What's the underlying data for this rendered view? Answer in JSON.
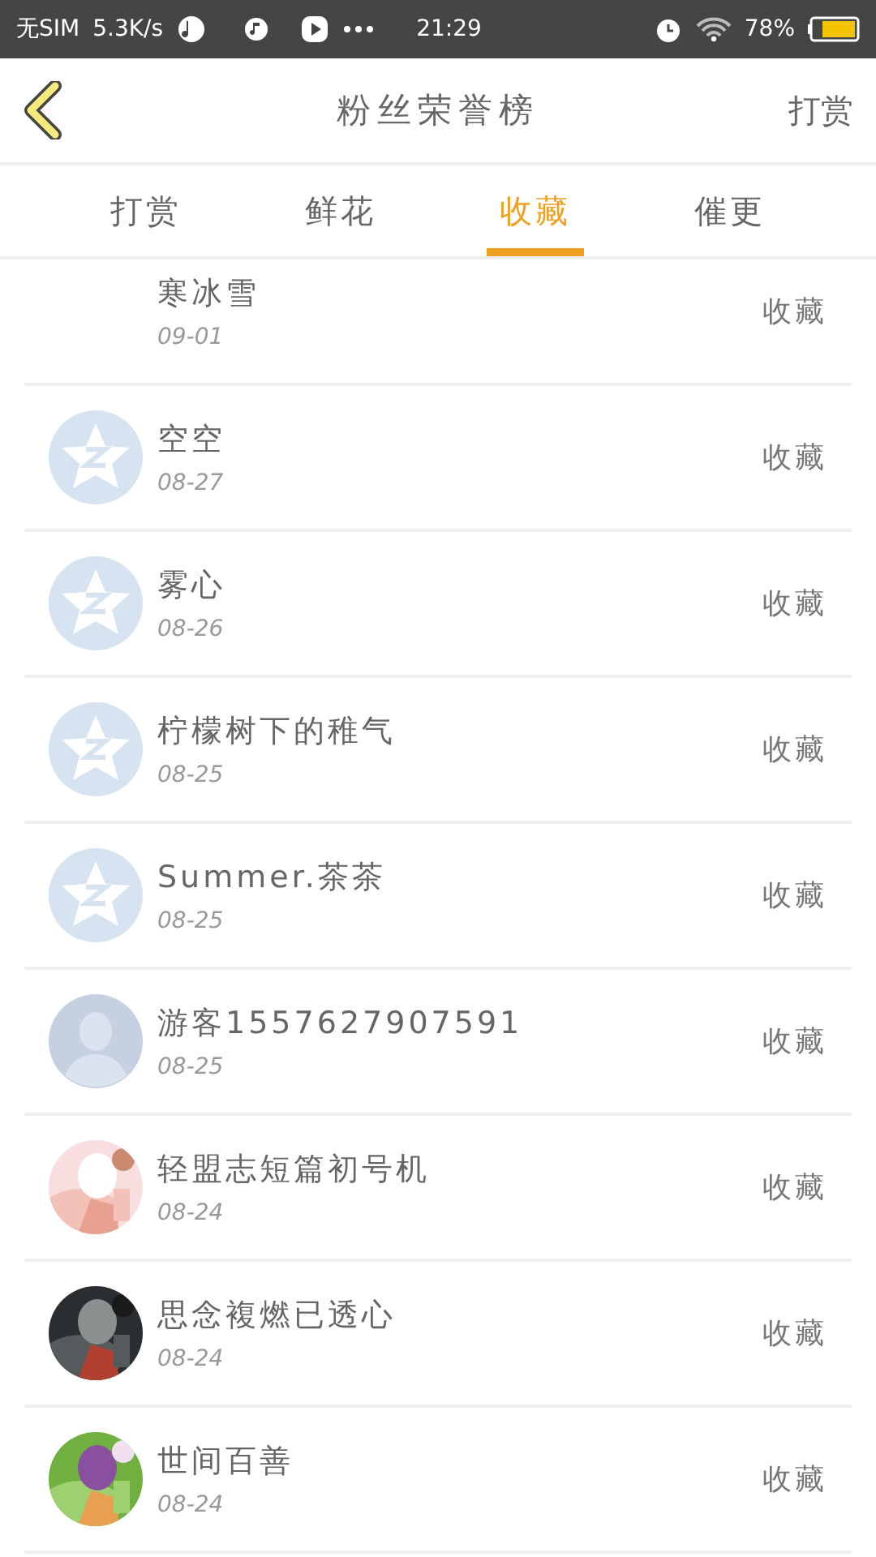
{
  "status_bar": {
    "carrier": "无SIM",
    "speed": "5.3K/s",
    "time": "21:29",
    "battery": "78%"
  },
  "header": {
    "title": "粉丝荣誉榜",
    "action": "打赏"
  },
  "tabs": [
    {
      "label": "打赏",
      "selected": false
    },
    {
      "label": "鲜花",
      "selected": false
    },
    {
      "label": "收藏",
      "selected": true
    },
    {
      "label": "催更",
      "selected": false
    }
  ],
  "fans": [
    {
      "name": "寒冰雪",
      "date": "09-01",
      "action": "收藏",
      "kind": "no-avatar"
    },
    {
      "name": "空空",
      "date": "08-27",
      "action": "收藏",
      "kind": "star"
    },
    {
      "name": "雾心",
      "date": "08-26",
      "action": "收藏",
      "kind": "star"
    },
    {
      "name": "柠檬树下的稚气",
      "date": "08-25",
      "action": "收藏",
      "kind": "star"
    },
    {
      "name": "Summer.茶茶",
      "date": "08-25",
      "action": "收藏",
      "kind": "star"
    },
    {
      "name": "游客1557627907591",
      "date": "08-25",
      "action": "收藏",
      "kind": "person"
    },
    {
      "name": "轻盟志短篇初号机",
      "date": "08-24",
      "action": "收藏",
      "kind": "picture"
    },
    {
      "name": "思念複燃已透心",
      "date": "08-24",
      "action": "收藏",
      "kind": "picture"
    },
    {
      "name": "世间百善",
      "date": "08-24",
      "action": "收藏",
      "kind": "picture"
    }
  ]
}
